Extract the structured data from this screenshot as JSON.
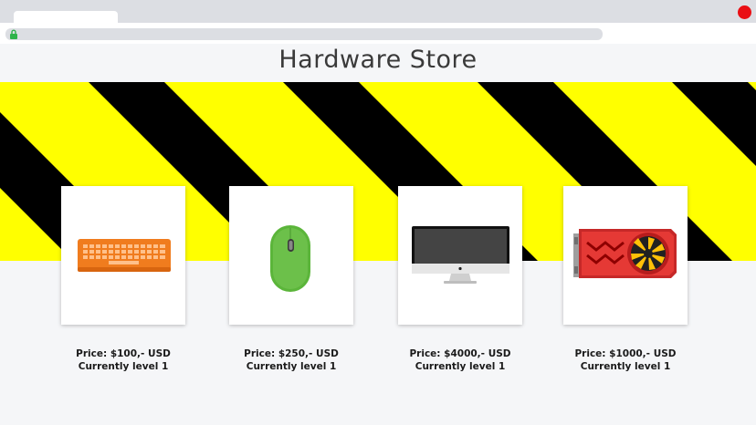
{
  "browser": {
    "close_color": "#ea0f14",
    "lock_icon": "lock-icon"
  },
  "page": {
    "title": "Hardware Store"
  },
  "banner": {
    "stripe_colors": [
      "#ffff00",
      "#000000"
    ]
  },
  "products": [
    {
      "icon": "keyboard-icon",
      "price": "Price: $100,- USD",
      "level": "Currently level 1",
      "color": "#f07c1e"
    },
    {
      "icon": "mouse-icon",
      "price": "Price: $250,- USD",
      "level": "Currently level 1",
      "color": "#6cc04a"
    },
    {
      "icon": "monitor-icon",
      "price": "Price: $4000,- USD",
      "level": "Currently level 1",
      "color": "#444444"
    },
    {
      "icon": "graphics-card-icon",
      "price": "Price: $1000,- USD",
      "level": "Currently level 1",
      "color": "#e53935"
    }
  ]
}
